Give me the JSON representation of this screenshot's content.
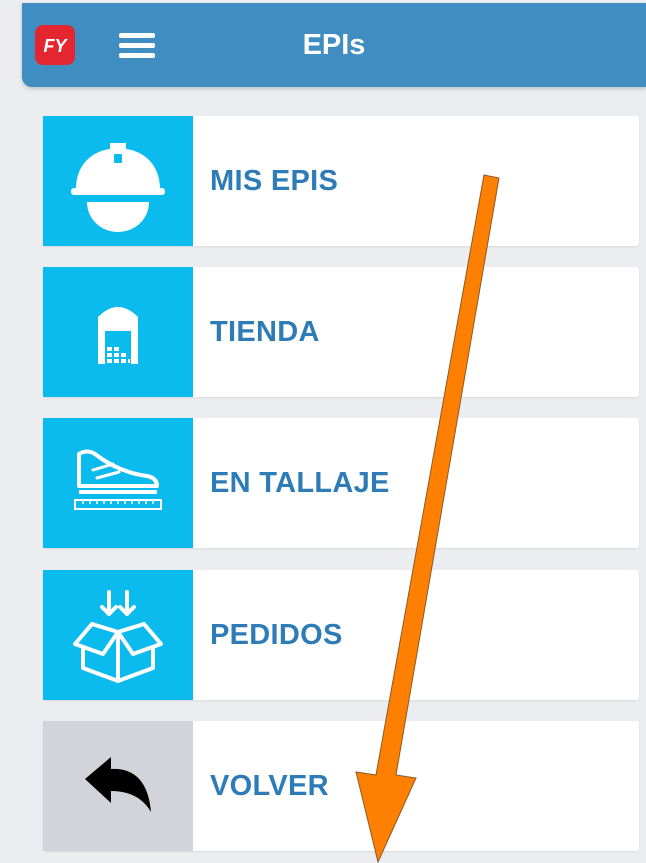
{
  "header": {
    "logo_text": "FY",
    "title": "EPIs",
    "menu_icon": "hamburger-icon"
  },
  "menu": [
    {
      "label": "MIS EPIS",
      "icon": "helmet-icon"
    },
    {
      "label": "TIENDA",
      "icon": "warehouse-icon"
    },
    {
      "label": "EN TALLAJE",
      "icon": "shoe-size-icon"
    },
    {
      "label": "PEDIDOS",
      "icon": "package-icon"
    },
    {
      "label": "VOLVER",
      "icon": "back-arrow-icon"
    }
  ],
  "colors": {
    "header": "#3f8dc1",
    "tile": "#0cbbee",
    "tile_back": "#d2d4d9",
    "label": "#2d7cb8",
    "background": "#ebedf0",
    "annotation_arrow": "#ff8000"
  }
}
